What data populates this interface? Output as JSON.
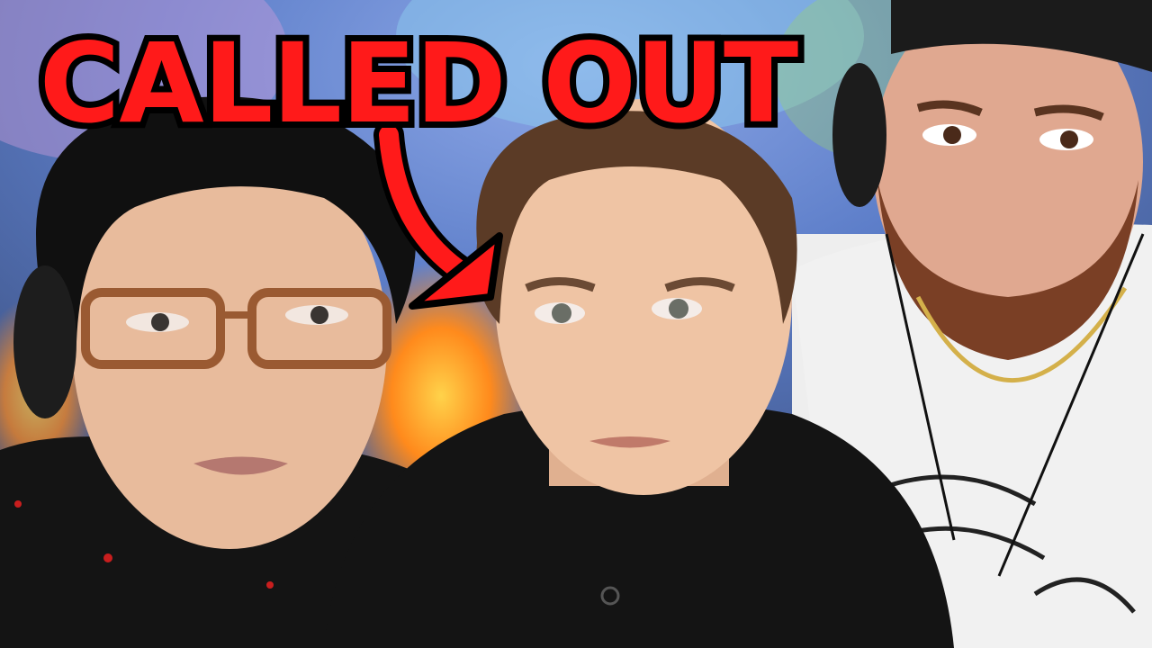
{
  "thumbnail": {
    "headline": "CALLED OUT"
  },
  "colors": {
    "headline_fill": "#ff1a1a",
    "headline_stroke": "#000000",
    "arrow": "#ff1a1a"
  },
  "icons": [
    "curved-arrow-icon"
  ]
}
